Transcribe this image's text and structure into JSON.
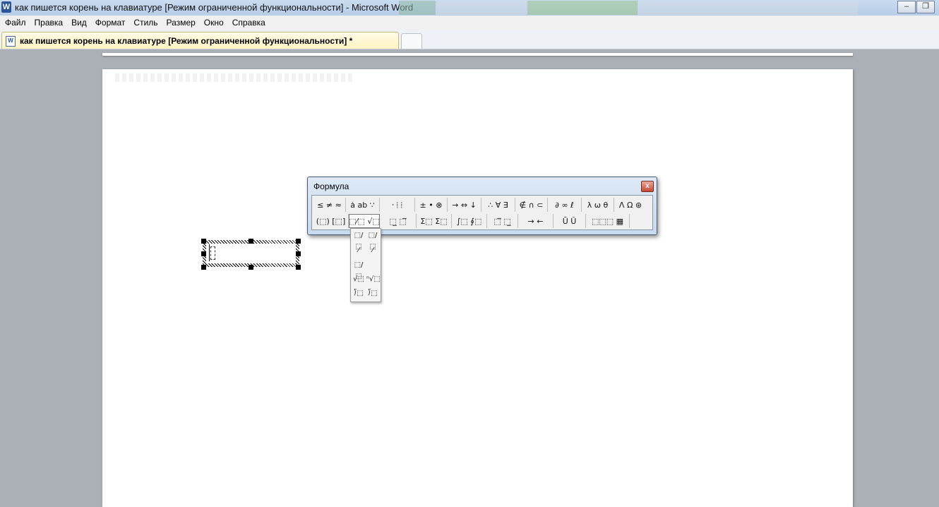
{
  "window": {
    "title": "как пишется корень на клавиатуре [Режим ограниченной функциональности] - Microsoft Word",
    "app_icon": "W",
    "controls": [
      "–",
      "❐"
    ]
  },
  "menubar": {
    "items": [
      "Файл",
      "Правка",
      "Вид",
      "Формат",
      "Стиль",
      "Размер",
      "Окно",
      "Справка"
    ]
  },
  "tabs": {
    "active_label": "как пишется корень на клавиатуре [Режим ограниченной функциональности] *",
    "close_label": "✕"
  },
  "formula_toolbar": {
    "title": "Формула",
    "close_label": "x",
    "row1": [
      "≤ ≠ ≈",
      "ȧ ab ∵",
      "⸱ ⦙ ⦙",
      "± • ⊗",
      "→ ⇔ ↓",
      "∴ ∀ ∃",
      "∉ ∩ ⊂",
      "∂ ∞ ℓ",
      "λ ω θ",
      "Λ Ω ⊛"
    ],
    "row2": [
      "(⬚) [⬚]",
      "⬚⁄⬚ √⬚",
      "⬚̲ ⬚̅",
      "Σ⬚ Σ⬚",
      "∫⬚ ∮⬚",
      "⬚̅ ⬚̲",
      "→ ←",
      "Ū Ǔ",
      "⬚⬚⬚ ▦"
    ]
  },
  "fraction_palette": {
    "items": [
      "⬚/⬚",
      "⬚/⬚",
      "⁄",
      "⁄",
      "⬚/⬚",
      "√⬚",
      "ⁿ√⬚",
      "⟌⬚",
      "⟌⬚"
    ]
  }
}
